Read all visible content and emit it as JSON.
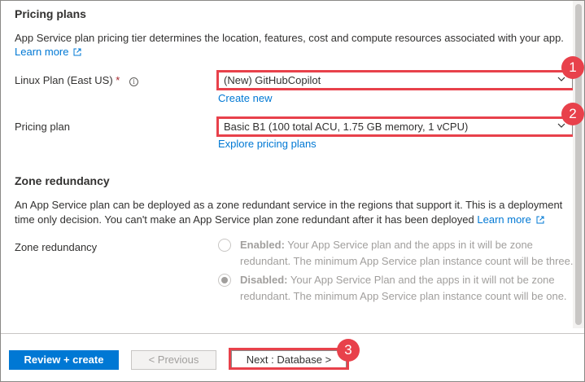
{
  "pricing": {
    "title": "Pricing plans",
    "description": "App Service plan pricing tier determines the location, features, cost and compute resources associated with your app.",
    "learn_more": "Learn more",
    "linux_plan_label": "Linux Plan (East US)",
    "required_mark": "*",
    "info_glyph": "i",
    "linux_plan_value": "(New) GitHubCopilot",
    "create_new": "Create new",
    "pricing_plan_label": "Pricing plan",
    "pricing_plan_value": "Basic B1 (100 total ACU, 1.75 GB memory, 1 vCPU)",
    "explore": "Explore pricing plans"
  },
  "zone": {
    "title": "Zone redundancy",
    "description_line1": "An App Service plan can be deployed as a zone redundant service in the regions that support it. This is a deployment",
    "description_line2": "time only decision. You can't make an App Service plan zone redundant after it has been deployed",
    "learn_more": "Learn more",
    "label": "Zone redundancy",
    "enabled_title": "Enabled:",
    "enabled_text": "Your App Service plan and the apps in it will be zone redundant. The minimum App Service plan instance count will be three.",
    "disabled_title": "Disabled:",
    "disabled_text": "Your App Service Plan and the apps in it will not be zone redundant. The minimum App Service plan instance count will be one.",
    "selected": "disabled"
  },
  "footer": {
    "review_create": "Review + create",
    "previous": "< Previous",
    "next": "Next : Database >"
  },
  "callouts": [
    "1",
    "2",
    "3"
  ],
  "colors": {
    "accent": "#0078d4",
    "callout": "#e8414b",
    "disabled": "#a19f9d"
  },
  "icons": {
    "external_link": "external-link-icon",
    "info": "info-icon",
    "chevron": "chevron-down-icon"
  }
}
